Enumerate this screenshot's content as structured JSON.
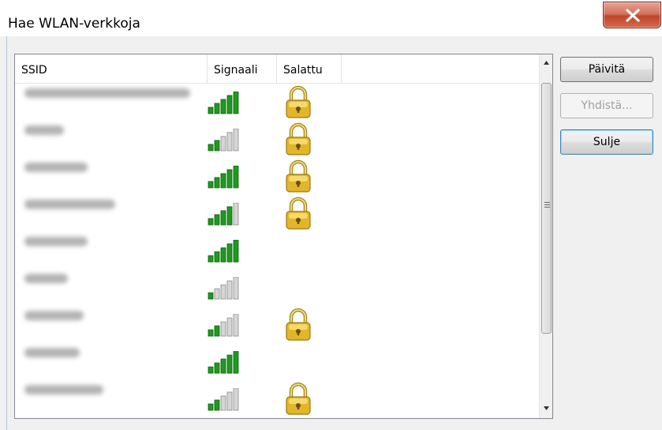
{
  "window": {
    "title": "Hae WLAN-verkkoja",
    "close_icon": "close-x-icon"
  },
  "list": {
    "columns": [
      "SSID",
      "Signaali",
      "Salattu",
      ""
    ],
    "rows": [
      {
        "ssid_hidden": true,
        "signal_bars": 5,
        "encrypted": true
      },
      {
        "ssid_hidden": true,
        "signal_bars": 2,
        "encrypted": true
      },
      {
        "ssid_hidden": true,
        "signal_bars": 5,
        "encrypted": true
      },
      {
        "ssid_hidden": true,
        "signal_bars": 4,
        "encrypted": true
      },
      {
        "ssid_hidden": true,
        "signal_bars": 5,
        "encrypted": false
      },
      {
        "ssid_hidden": true,
        "signal_bars": 1,
        "encrypted": false
      },
      {
        "ssid_hidden": true,
        "signal_bars": 2,
        "encrypted": true
      },
      {
        "ssid_hidden": true,
        "signal_bars": 5,
        "encrypted": false
      },
      {
        "ssid_hidden": true,
        "signal_bars": 2,
        "encrypted": true
      }
    ]
  },
  "buttons": {
    "refresh": "Päivitä",
    "connect": "Yhdistä...",
    "close": "Sulje"
  },
  "colors": {
    "signal_on": "#1f9a1f",
    "signal_off": "#d6d6d6",
    "lock_body": "#e3b52a",
    "titlebar_close": "#c7482e"
  }
}
